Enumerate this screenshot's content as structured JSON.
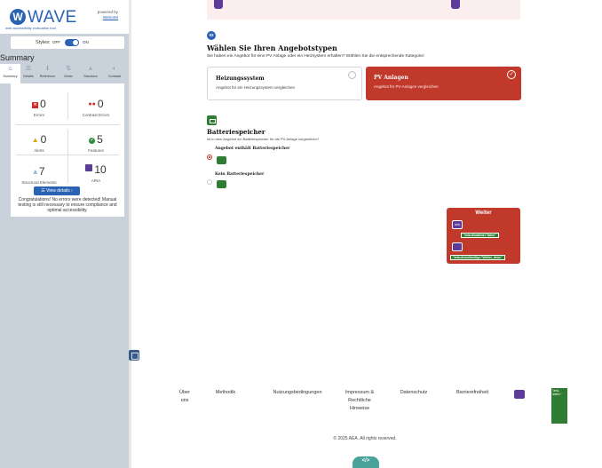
{
  "wave": {
    "logo_letter": "W",
    "logo_text": "WAVE",
    "tagline": "web accessibility evaluation tool",
    "powered_by": "powered by",
    "powered_link": "WebAIM",
    "styles_label": "Styles:",
    "styles_off": "OFF",
    "styles_on": "ON",
    "summary_heading": "Summary",
    "tabs": [
      {
        "icon": "home-icon",
        "glyph": "⌂",
        "label": "Summary"
      },
      {
        "icon": "list-icon",
        "glyph": "☰",
        "label": "Details"
      },
      {
        "icon": "info-icon",
        "glyph": "ℹ",
        "label": "Reference"
      },
      {
        "icon": "order-icon",
        "glyph": "⇅",
        "label": "Order"
      },
      {
        "icon": "structure-icon",
        "glyph": "⩓",
        "label": "Structure"
      },
      {
        "icon": "contrast-icon",
        "glyph": "◐",
        "label": "Contrast"
      }
    ],
    "stats": {
      "errors": {
        "value": "0",
        "label": "Errors"
      },
      "contrast_errors": {
        "value": "0",
        "label": "Contrast Errors"
      },
      "alerts": {
        "value": "0",
        "label": "Alerts"
      },
      "features": {
        "value": "5",
        "label": "Features"
      },
      "structural": {
        "value": "7",
        "label": "Structural Elements"
      },
      "aria": {
        "value": "10",
        "label": "ARIA"
      }
    },
    "details_button": "☰ View details ›",
    "congrats": "Congratulations! No errors were detected! Manual testing is still necessary to ensure compliance and optimal accessibility."
  },
  "page": {
    "step_number": "02",
    "section1_title": "Wählen Sie Ihren Angebotstypen",
    "section1_sub": "Sie haben ein Angebot für eine PV Anlage oder ein Heizsystem erhalten? Wählen Sie die entsprechende Kategorie:",
    "card_a": {
      "title": "Heizungssystem",
      "sub": "Angebot für ein Heizungssystem vergleichen"
    },
    "card_b": {
      "title": "PV Anlagen",
      "sub": "Angebot für PV-Anlagen vergleichen"
    },
    "section2_title": "Batteriespeicher",
    "section2_sub": "Ist in dem Angebot ein Batteriespeicher für die PV-Anlage vorgesehen?",
    "option1": "Angebot enthält Batteriespeicher",
    "option2": "Kein Batteriespeicher",
    "weiter_label": "Weiter",
    "aria_icon_text": "aria",
    "aria_tag1": "\"aria-disabled=\"false\"",
    "aria_tag2": "\"aria-describedby=\"Weiter_desc\"",
    "accent_red": "#c0392b",
    "accent_blue": "#2a63b4"
  },
  "footer": {
    "links": [
      "Über uns",
      "Methodik",
      "Nutzungsbedingungen",
      "Impressum & Rechtliche Hinweise",
      "Datenschutz",
      "Barrierefreiheit"
    ],
    "aria_label_tag": "\"aria-label=\"",
    "copyright": "© 2025 AEA. All rights reserved.",
    "code_icon_text": "</>"
  }
}
